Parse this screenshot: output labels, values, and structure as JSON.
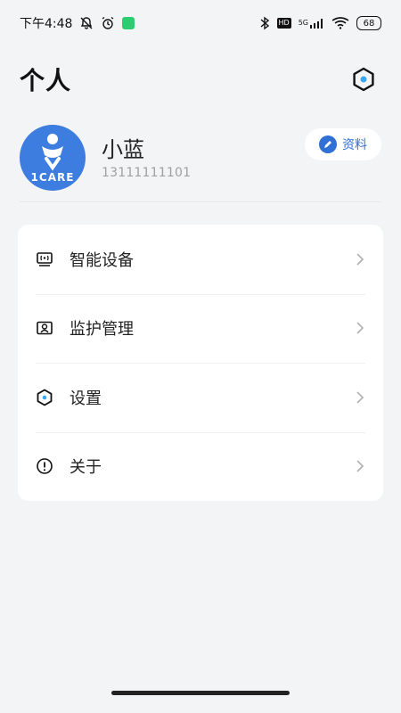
{
  "status": {
    "time": "下午4:48",
    "hd": "HD",
    "network": "5G",
    "battery": "68"
  },
  "header": {
    "title": "个人"
  },
  "profile": {
    "name": "小蓝",
    "phone": "13111111101",
    "edit_label": "资料",
    "avatar_text": "1CARE"
  },
  "menu": {
    "items": [
      {
        "label": "智能设备",
        "icon": "smart-device-icon"
      },
      {
        "label": "监护管理",
        "icon": "guardian-management-icon"
      },
      {
        "label": "设置",
        "icon": "settings-icon"
      },
      {
        "label": "关于",
        "icon": "info-icon"
      }
    ]
  },
  "colors": {
    "accent": "#2f6fd6",
    "background": "#f3f4f6",
    "card": "#ffffff",
    "avatar": "#3d7de0"
  }
}
